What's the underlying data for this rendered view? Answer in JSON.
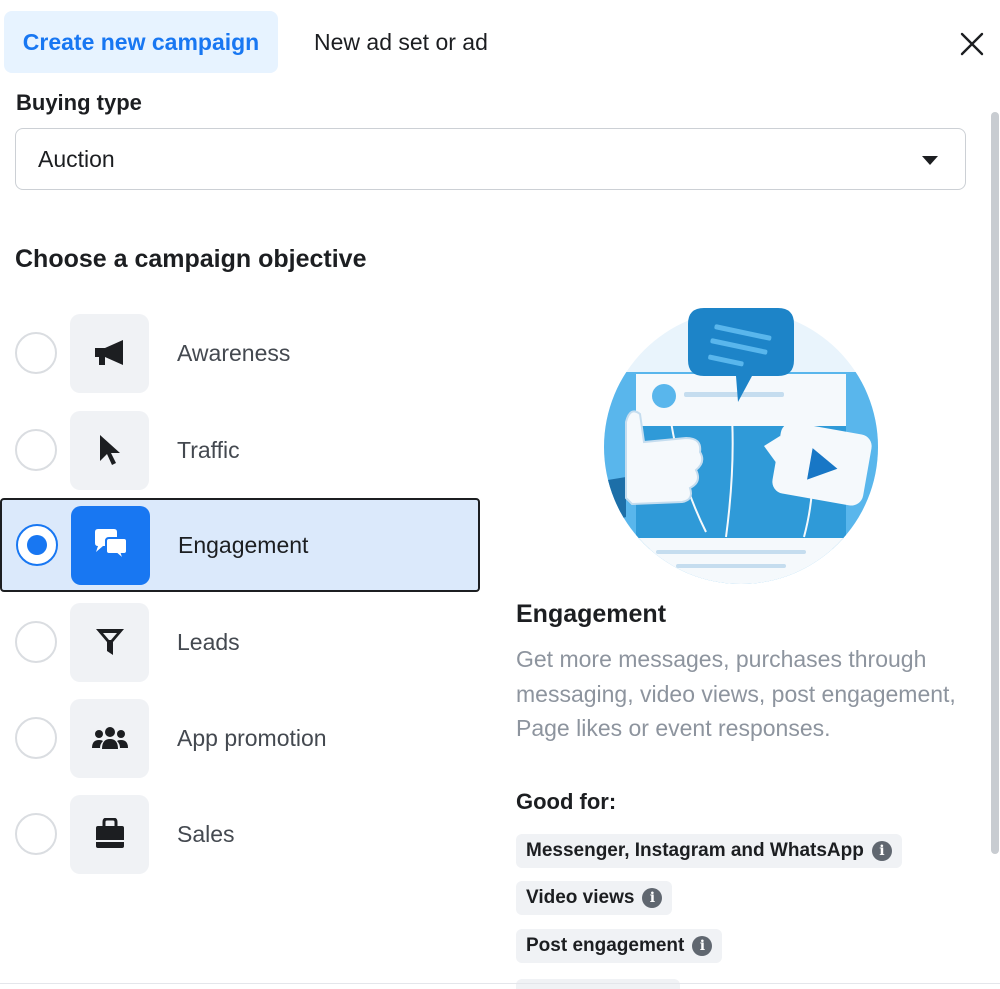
{
  "tabs": {
    "active": "Create new campaign",
    "inactive": "New ad set or ad"
  },
  "buying_type": {
    "label": "Buying type",
    "value": "Auction"
  },
  "objective_section": {
    "title": "Choose a campaign objective",
    "selected": "Engagement",
    "items": [
      {
        "label": "Awareness",
        "icon": "megaphone-icon",
        "selected": false
      },
      {
        "label": "Traffic",
        "icon": "cursor-icon",
        "selected": false
      },
      {
        "label": "Engagement",
        "icon": "chat-bubbles-icon",
        "selected": true
      },
      {
        "label": "Leads",
        "icon": "funnel-icon",
        "selected": false
      },
      {
        "label": "App promotion",
        "icon": "people-icon",
        "selected": false
      },
      {
        "label": "Sales",
        "icon": "shopping-bag-icon",
        "selected": false
      }
    ]
  },
  "detail": {
    "title": "Engagement",
    "description": "Get more messages, purchases through messaging, video views, post engagement, Page likes or event responses.",
    "good_for_label": "Good for:",
    "chips": [
      "Messenger, Instagram and WhatsApp",
      "Video views",
      "Post engagement"
    ]
  },
  "colors": {
    "accent": "#1877f2",
    "selected_bg": "#dbe9fb",
    "tab_active_bg": "#e7f3ff",
    "icon_bg": "#f0f2f5",
    "muted_text": "#8d949e"
  }
}
